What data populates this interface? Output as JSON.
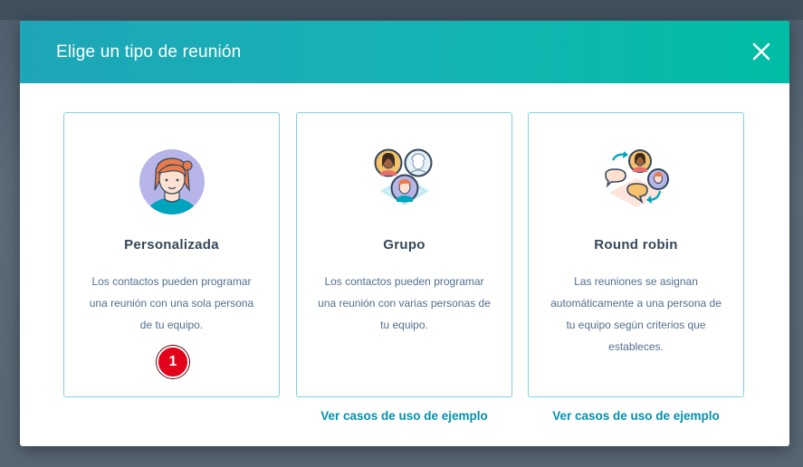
{
  "modal": {
    "title": "Elige un tipo de reunión",
    "close_icon": "close-icon"
  },
  "cards": [
    {
      "title": "Personalizada",
      "description": "Los contactos pueden programar una reunión con una sola persona de tu equipo.",
      "icon": "single-person-icon"
    },
    {
      "title": "Grupo",
      "description": "Los contactos pueden programar una reunión con varias personas de tu equipo.",
      "icon": "group-people-icon",
      "link": "Ver casos de uso de ejemplo"
    },
    {
      "title": "Round robin",
      "description": "Las reuniones se asignan automáticamente a una persona de tu equipo según criterios que estableces.",
      "icon": "round-robin-icon",
      "link": "Ver casos de uso de ejemplo"
    }
  ],
  "annotation": {
    "badge": "1"
  },
  "colors": {
    "header_start": "#1ea6b8",
    "header_end": "#00bda5",
    "card_border": "#7fd1de",
    "link": "#0091ae",
    "title_text": "#33475b",
    "body_text": "#516f90",
    "badge": "#e3001b"
  }
}
